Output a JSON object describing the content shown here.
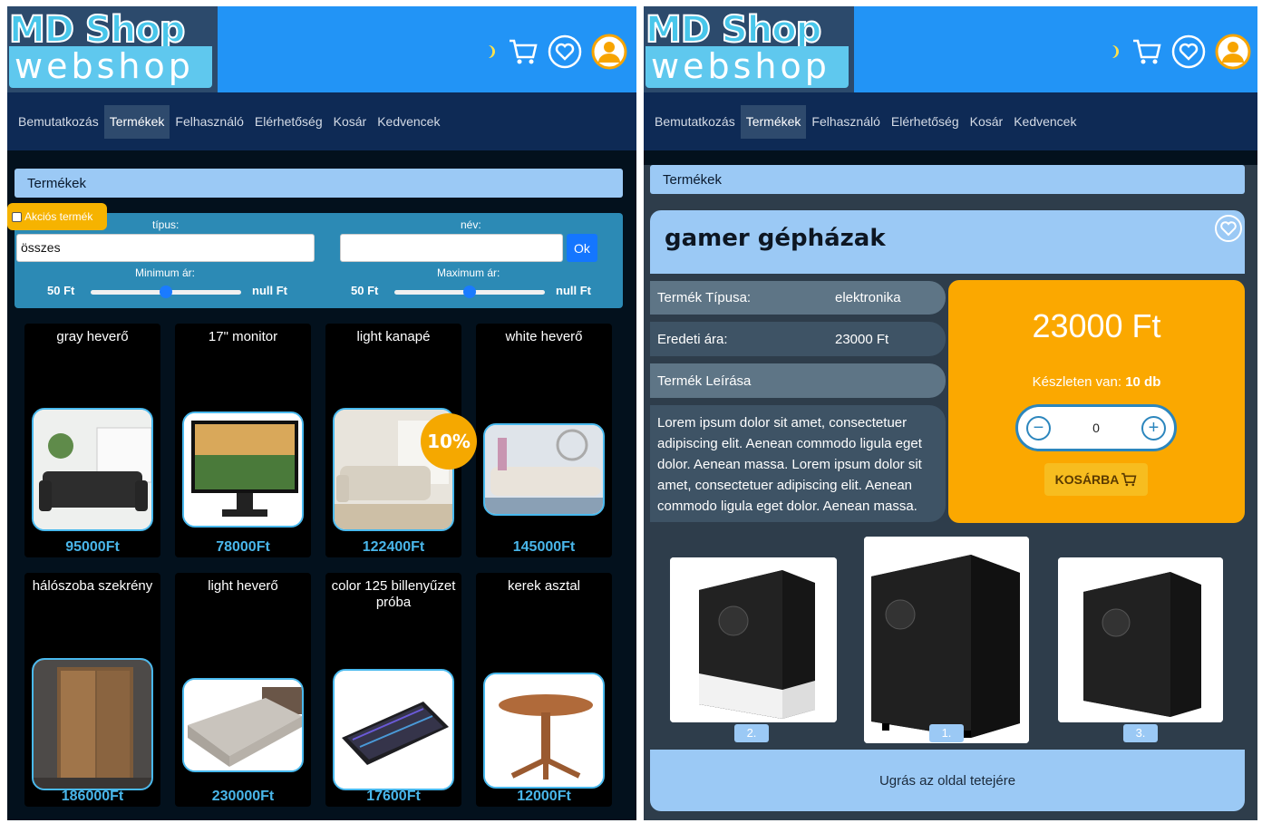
{
  "left": {
    "nav": [
      "Bemutatkozás",
      "Termékek",
      "Felhasználó",
      "Elérhetőség",
      "Kosár",
      "Kedvencek"
    ],
    "breadcrumb": "Termékek",
    "filter": {
      "akcios_label": "Akciós termék",
      "tipus_label": "típus:",
      "tipus_value": "összes",
      "nev_label": "név:",
      "nev_value": "",
      "ok_label": "Ok",
      "min_label": "Minimum ár:",
      "max_label": "Maximum ár:",
      "min_left": "50 Ft",
      "min_right": "null Ft",
      "max_left": "50 Ft",
      "max_right": "null Ft",
      "min_slider_fraction": 0.5,
      "max_slider_fraction": 0.5
    },
    "products": [
      {
        "name": "gray heverő",
        "price": "95000Ft",
        "icon": "sofa-image"
      },
      {
        "name": "17\" monitor",
        "price": "78000Ft",
        "icon": "monitor-image"
      },
      {
        "name": "light kanapé",
        "price": "122400Ft",
        "icon": "couch-image",
        "badge": "10%"
      },
      {
        "name": "white heverő",
        "price": "145000Ft",
        "icon": "sofa-image"
      },
      {
        "name": "hálószoba szekrény",
        "price": "186000Ft",
        "icon": "wardrobe-image"
      },
      {
        "name": "light heverő",
        "price": "230000Ft",
        "icon": "bed-image"
      },
      {
        "name": "color 125 billenyűzet próba",
        "price": "17600Ft",
        "icon": "keyboard-image"
      },
      {
        "name": "kerek asztal",
        "price": "12000Ft",
        "icon": "table-image"
      }
    ]
  },
  "right": {
    "nav": [
      "Bemutatkozás",
      "Termékek",
      "Felhasználó",
      "Elérhetőség",
      "Kosár",
      "Kedvencek"
    ],
    "breadcrumb": "Termékek",
    "product": {
      "title": "gamer gépházak",
      "type_label": "Termék Típusa:",
      "type_value": "elektronika",
      "orig_label": "Eredeti ára:",
      "orig_value": "23000 Ft",
      "desc_label": "Termék Leírása",
      "description": "Lorem ipsum dolor sit amet, consectetuer adipiscing elit. Aenean commodo ligula eget dolor. Aenean massa. Lorem ipsum dolor sit amet, consectetuer adipiscing elit. Aenean commodo ligula eget dolor. Aenean massa.",
      "price": "23000 Ft",
      "stock_prefix": "Készleten van: ",
      "stock_value": "10 db",
      "quantity": "0",
      "cart_button": "KOSÁRBA"
    },
    "thumbnails": [
      {
        "label": "2."
      },
      {
        "label": "1."
      },
      {
        "label": "3."
      }
    ],
    "footer": "Ugrás az oldal tetejére"
  },
  "colors": {
    "header_blue": "#2294f6",
    "nav": "#0e2a55",
    "accent_orange": "#fba800",
    "light_blue": "#9bc9f5",
    "price_blue": "#49b6ea"
  }
}
